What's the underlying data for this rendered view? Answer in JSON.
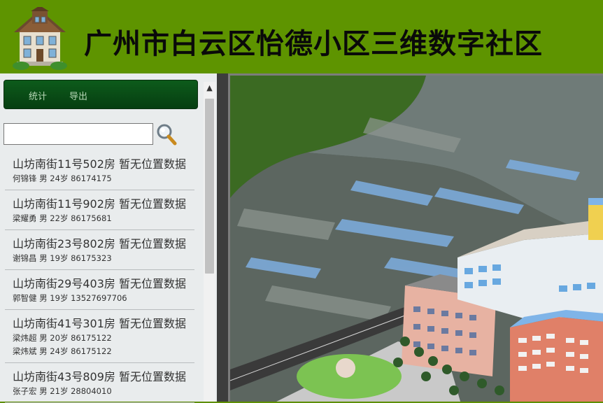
{
  "header": {
    "title": "广州市白云区怡德小区三维数字社区",
    "logo_icon": "house-icon"
  },
  "toolbar": {
    "buttons": [
      {
        "label": "统计"
      },
      {
        "label": "导出"
      }
    ]
  },
  "search": {
    "value": "",
    "icon": "magnifier-icon"
  },
  "residents": [
    {
      "address": "山坊南街11号502房",
      "status": "暂无位置数据",
      "people": [
        "何锦锋 男 24岁 86174175"
      ]
    },
    {
      "address": "山坊南街11号902房",
      "status": "暂无位置数据",
      "people": [
        "梁耀勇 男 22岁 86175681"
      ]
    },
    {
      "address": "山坊南街23号802房",
      "status": "暂无位置数据",
      "people": [
        "谢锦昌 男 19岁 86175323"
      ]
    },
    {
      "address": "山坊南街29号403房",
      "status": "暂无位置数据",
      "people": [
        "郭智健 男 19岁 13527697706"
      ]
    },
    {
      "address": "山坊南街41号301房",
      "status": "暂无位置数据",
      "people": [
        "梁炜超 男 20岁 86175122",
        "梁炜斌 男 24岁 86175122"
      ]
    },
    {
      "address": "山坊南街43号809房",
      "status": "暂无位置数据",
      "people": [
        "张子宏 男 21岁 28804010"
      ]
    }
  ],
  "colors": {
    "header_bg": "#5e9400",
    "toolbar_bg": "#0a4d16",
    "panel_bg": "#e9eced"
  }
}
